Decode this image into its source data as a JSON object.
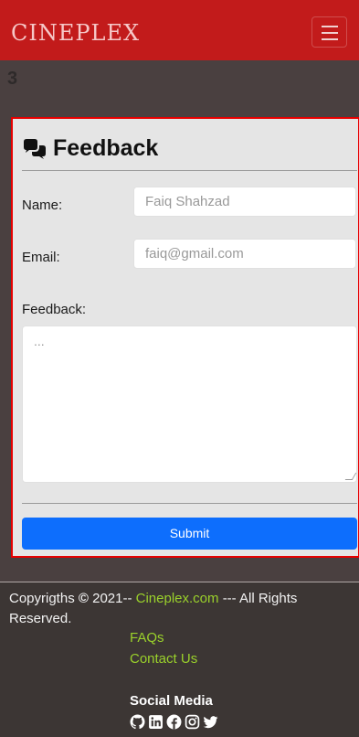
{
  "navbar": {
    "brand": "CINEPLEX",
    "toggle_icon": "hamburger-menu-icon"
  },
  "page_number": "3",
  "feedback": {
    "title": "Feedback",
    "title_icon": "comments-icon",
    "name_label": "Name:",
    "name_value": "Faiq Shahzad",
    "email_label": "Email:",
    "email_value": "faiq@gmail.com",
    "feedback_label": "Feedback:",
    "feedback_placeholder": "...",
    "submit_label": "Submit"
  },
  "footer": {
    "copyright_prefix": "Copyrigths",
    "copyright_symbol": "©",
    "copyright_year": "2021--",
    "site_link": "Cineplex.com",
    "copyright_suffix": "--- All Rights Reserved.",
    "links": [
      "FAQs",
      "Contact Us"
    ],
    "social_heading": "Social Media",
    "social_icons": [
      "github-icon",
      "linkedin-icon",
      "facebook-icon",
      "instagram-icon",
      "twitter-icon"
    ]
  },
  "colors": {
    "navbar": "#c21b1b",
    "background": "#4a4040",
    "card": "#e5e5e5",
    "card_border": "#e60000",
    "submit": "#0d6efd",
    "footer": "#3c3634",
    "link": "#9ad12b"
  }
}
